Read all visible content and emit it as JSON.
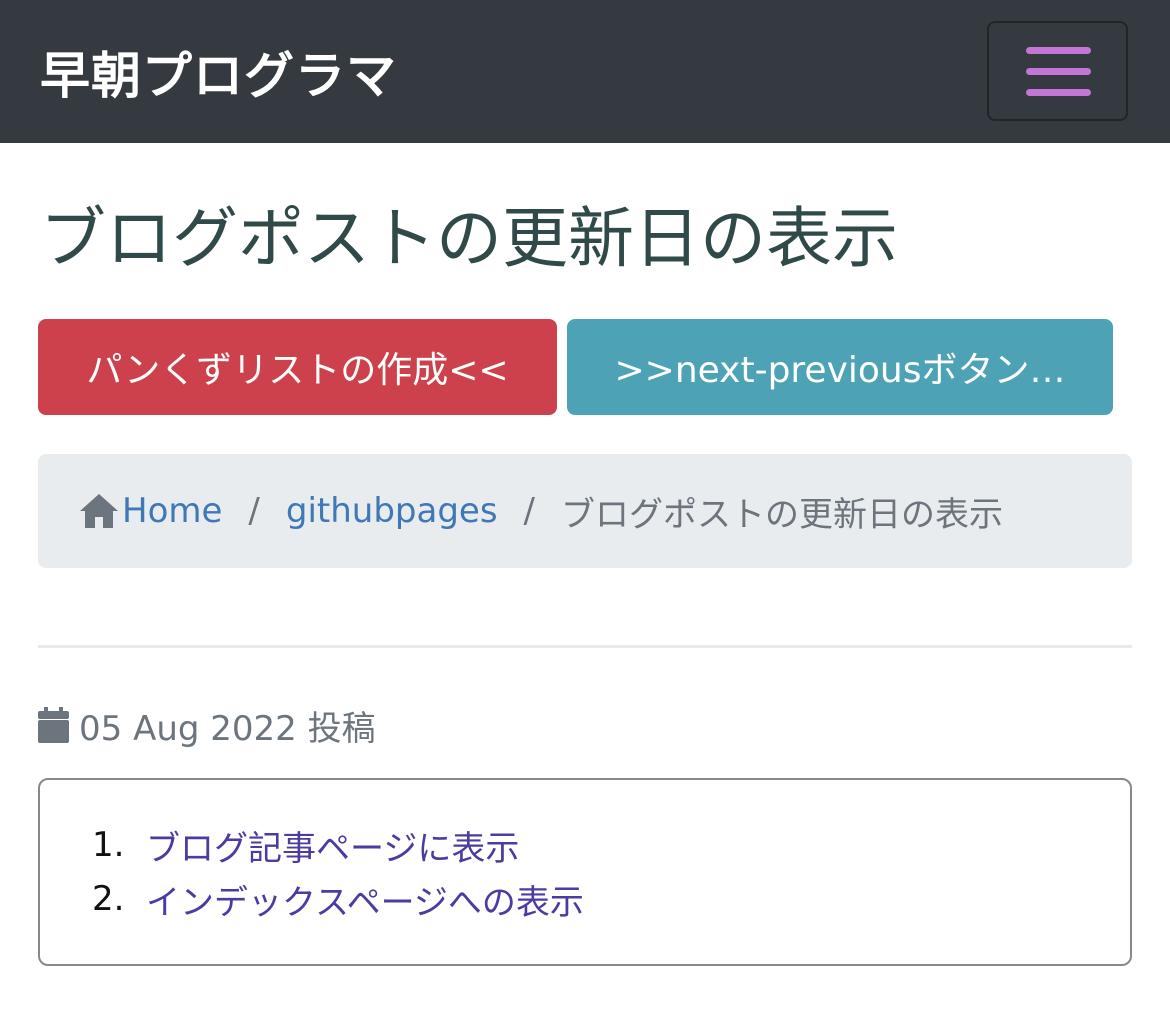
{
  "navbar": {
    "brand": "早朝プログラマ",
    "toggler_icon": "hamburger-icon",
    "toggler_color": "#c376d7",
    "background": "#343a40"
  },
  "page": {
    "title": "ブログポストの更新日の表示"
  },
  "post_nav": {
    "previous_label": "パンくずリストの作成<<",
    "next_label": ">>next-previousボタン…",
    "previous_color": "#cc414b",
    "next_color": "#4ea2b5"
  },
  "breadcrumb": {
    "home_icon": "home-icon",
    "home_label": "Home",
    "separator": "/",
    "category_label": "githubpages",
    "current_label": "ブログポストの更新日の表示"
  },
  "meta": {
    "calendar_icon": "calendar-icon",
    "date_text": "05 Aug 2022 投稿"
  },
  "toc": {
    "items": [
      {
        "number": "1.",
        "label": "ブログ記事ページに表示"
      },
      {
        "number": "2.",
        "label": "インデックスページへの表示"
      }
    ]
  }
}
